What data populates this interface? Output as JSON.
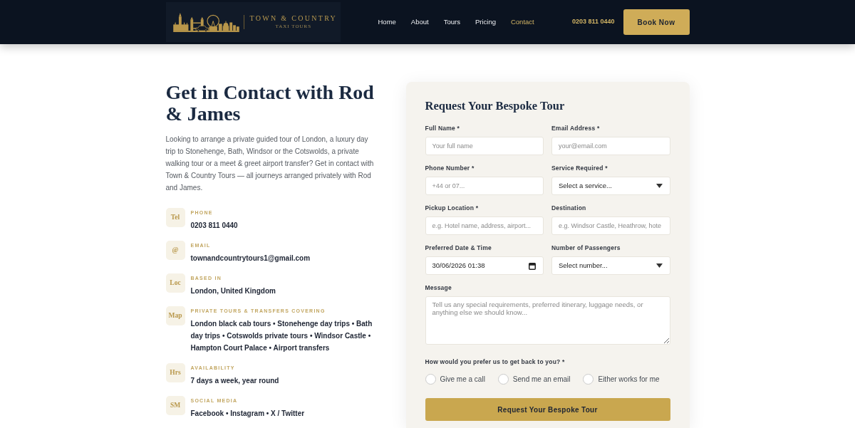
{
  "header": {
    "logo": {
      "title": "TOWN & COUNTRY",
      "subtitle": "TAXI TOURS"
    },
    "nav": [
      {
        "label": "Home",
        "selected": false
      },
      {
        "label": "About",
        "selected": false
      },
      {
        "label": "Tours",
        "selected": false
      },
      {
        "label": "Pricing",
        "selected": false
      },
      {
        "label": "Contact",
        "selected": true
      }
    ],
    "phone": "0203 811 0440",
    "cta": "Book Now"
  },
  "contact": {
    "heading": "Get in Contact with Rod & James",
    "intro": "Looking to arrange a private guided tour of London, a luxury day trip to Stonehenge, Bath, Windsor or the Cotswolds, a private walking tour or a meet & greet airport transfer? Get in contact with Town & Country Tours — all journeys arranged privately with Rod and James.",
    "items": [
      {
        "tile": "Tel",
        "label": "PHONE",
        "value": "0203 811 0440"
      },
      {
        "tile": "@",
        "label": "EMAIL",
        "value": "townandcountrytours1@gmail.com"
      },
      {
        "tile": "Loc",
        "label": "BASED IN",
        "value": "London, United Kingdom"
      },
      {
        "tile": "Map",
        "label": "PRIVATE TOURS & TRANSFERS COVERING",
        "value": "London black cab tours • Stonehenge day trips • Bath day trips • Cotswolds private tours • Windsor Castle • Hampton Court Palace • Airport transfers"
      },
      {
        "tile": "Hrs",
        "label": "AVAILABILITY",
        "value": "7 days a week, year round"
      },
      {
        "tile": "SM",
        "label": "SOCIAL MEDIA",
        "value": "Facebook • Instagram • X / Twitter"
      }
    ]
  },
  "form": {
    "title": "Request Your Bespoke Tour",
    "fields": [
      {
        "kind": "text",
        "label": "Full Name *",
        "placeholder": "Your full name"
      },
      {
        "kind": "text",
        "label": "Email Address *",
        "placeholder": "your@email.com"
      },
      {
        "kind": "text",
        "label": "Phone Number *",
        "placeholder": "+44 or 07..."
      },
      {
        "kind": "select",
        "label": "Service Required *",
        "value": "Select a service..."
      },
      {
        "kind": "text",
        "label": "Pickup Location *",
        "placeholder": "e.g. Hotel name, address, airport..."
      },
      {
        "kind": "text",
        "label": "Destination",
        "placeholder": "e.g. Windsor Castle, Heathrow, hote"
      },
      {
        "kind": "datetime",
        "label": "Preferred Date & Time",
        "value": "30/06/2026 01:38"
      },
      {
        "kind": "select",
        "label": "Number of Passengers",
        "value": "Select number..."
      },
      {
        "kind": "textarea",
        "label": "Message",
        "placeholder": "Tell us any special requirements, preferred itinerary, luggage needs, or anything else we should know..."
      }
    ],
    "contact_preference": {
      "question": "How would you prefer us to get back to you? *",
      "options": [
        {
          "label": "Give me a call",
          "selected": false
        },
        {
          "label": "Send me an email",
          "selected": false
        },
        {
          "label": "Either works for me",
          "selected": false
        }
      ]
    },
    "submit": "Request Your Bespoke Tour"
  }
}
